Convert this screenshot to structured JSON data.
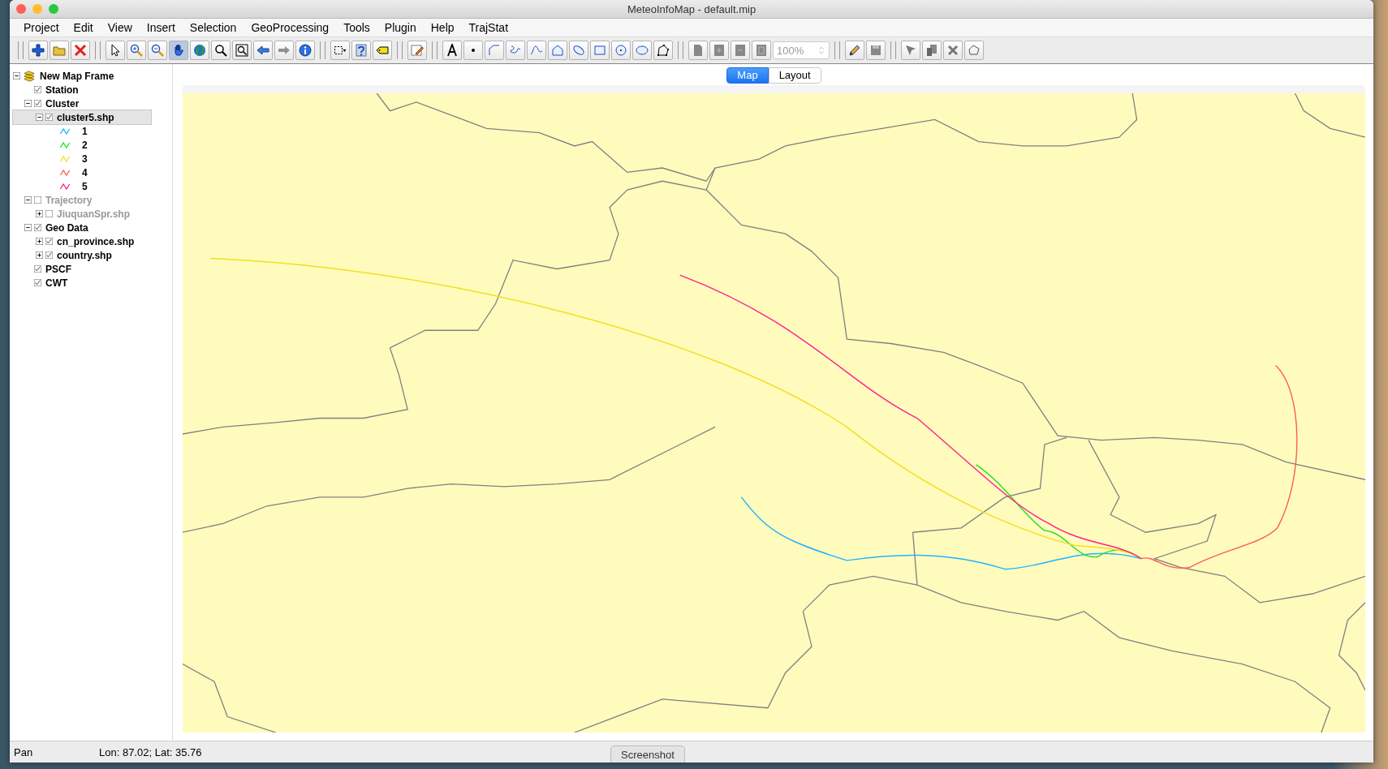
{
  "window": {
    "title": "MeteoInfoMap - default.mip"
  },
  "menu": [
    "Project",
    "Edit",
    "View",
    "Insert",
    "Selection",
    "GeoProcessing",
    "Tools",
    "Plugin",
    "Help",
    "TrajStat"
  ],
  "toolbar": {
    "zoom_field": "100%"
  },
  "tree": {
    "label": "New Map Frame",
    "expanded": true,
    "children": [
      {
        "kind": "layer",
        "label": "Station",
        "checked": true,
        "selected": false,
        "disabled": false
      },
      {
        "kind": "layer",
        "label": "Cluster",
        "checked": true,
        "expanded": true,
        "selected": false,
        "disabled": false,
        "children": [
          {
            "kind": "layer",
            "label": "cluster5.shp",
            "checked": true,
            "expanded": true,
            "selected": true,
            "disabled": false,
            "children": [
              {
                "kind": "legend",
                "label": "1",
                "color": "#22b4ff"
              },
              {
                "kind": "legend",
                "label": "2",
                "color": "#22e022"
              },
              {
                "kind": "legend",
                "label": "3",
                "color": "#f0e020"
              },
              {
                "kind": "legend",
                "label": "4",
                "color": "#ff5a5a"
              },
              {
                "kind": "legend",
                "label": "5",
                "color": "#ff2090"
              }
            ]
          }
        ]
      },
      {
        "kind": "layer",
        "label": "Trajectory",
        "checked": false,
        "expanded": true,
        "selected": false,
        "disabled": true,
        "children": [
          {
            "kind": "layer",
            "label": "JiuquanSpr.shp",
            "checked": false,
            "expanded": false,
            "selected": false,
            "disabled": true
          }
        ]
      },
      {
        "kind": "layer",
        "label": "Geo Data",
        "checked": true,
        "expanded": true,
        "selected": false,
        "disabled": false,
        "children": [
          {
            "kind": "layer",
            "label": "cn_province.shp",
            "checked": true,
            "expanded": false,
            "selected": false,
            "disabled": false
          },
          {
            "kind": "layer",
            "label": "country.shp",
            "checked": true,
            "expanded": false,
            "selected": false,
            "disabled": false
          }
        ]
      },
      {
        "kind": "layer",
        "label": "PSCF",
        "checked": true,
        "selected": false,
        "disabled": false
      },
      {
        "kind": "layer",
        "label": "CWT",
        "checked": true,
        "selected": false,
        "disabled": false
      }
    ]
  },
  "tabs": [
    {
      "label": "Map",
      "selected": true
    },
    {
      "label": "Layout",
      "selected": false
    }
  ],
  "status_bar": {
    "mode": "Pan",
    "coordinates": "Lon: 87.02; Lat: 35.76"
  },
  "overlay_button": "Screenshot"
}
